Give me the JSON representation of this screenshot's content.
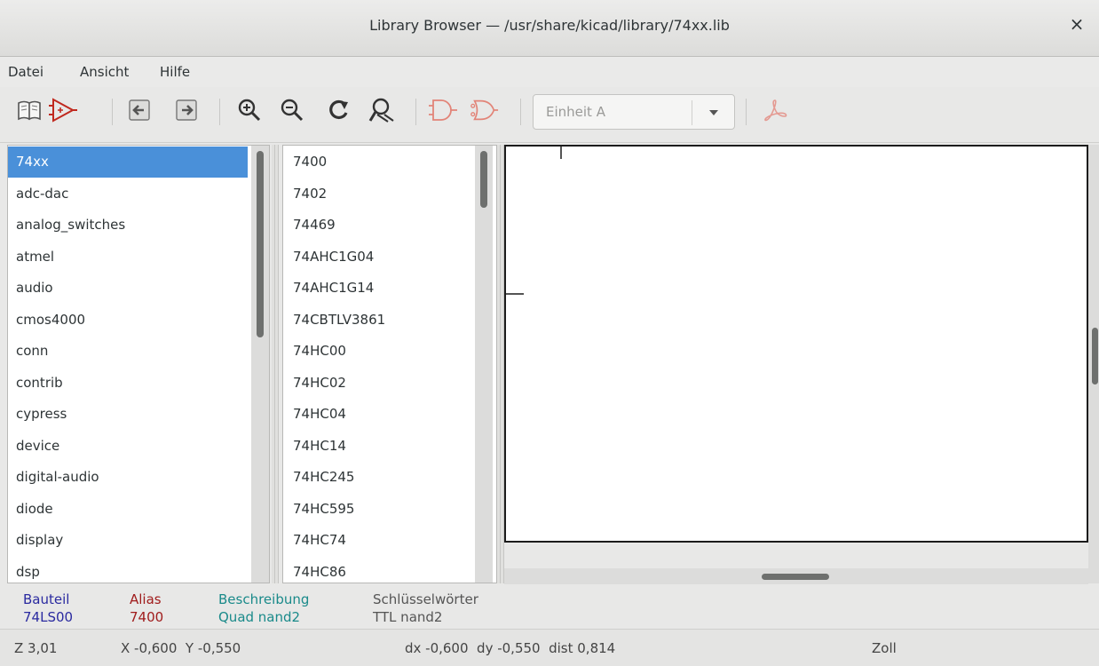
{
  "window": {
    "title": "Library Browser — /usr/share/kicad/library/74xx.lib",
    "close_symbol": "×"
  },
  "menu": {
    "items": [
      "Datei",
      "Ansicht",
      "Hilfe"
    ]
  },
  "toolbar": {
    "icons": [
      "library-book-icon",
      "select-part-icon",
      "previous-part-icon",
      "next-part-icon",
      "zoom-in-icon",
      "zoom-out-icon",
      "redraw-icon",
      "zoom-fit-icon",
      "de-morgan-normal-icon",
      "de-morgan-converted-icon",
      "pdf-datasheet-icon"
    ],
    "unit_select": {
      "value": "Einheit A"
    }
  },
  "libraries": {
    "items": [
      "74xx",
      "adc-dac",
      "analog_switches",
      "atmel",
      "audio",
      "cmos4000",
      "conn",
      "contrib",
      "cypress",
      "device",
      "digital-audio",
      "diode",
      "display",
      "dsp"
    ],
    "selected": "74xx"
  },
  "parts": {
    "items": [
      "7400",
      "7402",
      "74469",
      "74AHC1G04",
      "74AHC1G14",
      "74CBTLV3861",
      "74HC00",
      "74HC02",
      "74HC04",
      "74HC14",
      "74HC245",
      "74HC595",
      "74HC74",
      "74HC86"
    ]
  },
  "info": {
    "headers": {
      "part": "Bauteil",
      "alias": "Alias",
      "description": "Beschreibung",
      "keywords": "Schlüsselwörter"
    },
    "values": {
      "part": "74LS00",
      "alias": "7400",
      "description": "Quad nand2",
      "keywords": "TTL nand2"
    },
    "colors": {
      "part": "#2a2aa0",
      "alias": "#a01c1c",
      "description": "#1a8a8a",
      "keywords": "#555555"
    }
  },
  "status": {
    "zoom": "Z 3,01",
    "xy": "X -0,600  Y -0,550",
    "delta": "dx -0,600  dy -0,550  dist 0,814",
    "units": "Zoll"
  },
  "colors": {
    "selection": "#4a90d9",
    "icon_red": "#c0281e"
  }
}
